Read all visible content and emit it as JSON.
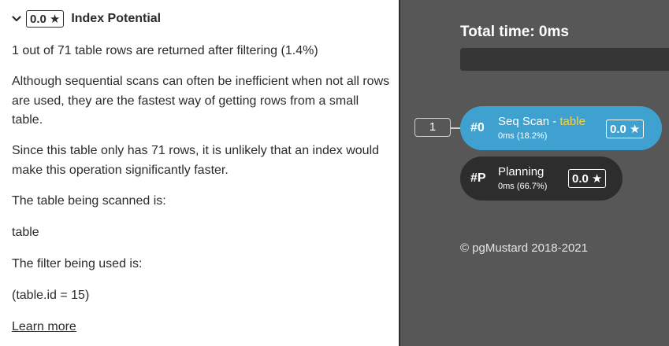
{
  "panel": {
    "score": "0.0",
    "title": "Index Potential",
    "paragraphs": [
      "1 out of 71 table rows are returned after filtering (1.4%)",
      "Although sequential scans can often be inefficient when not all rows are used, they are the fastest way of getting rows from a small table.",
      "Since this table only has 71 rows, it is unlikely that an index would make this operation significantly faster.",
      "The table being scanned is:",
      "table",
      "The filter being used is:",
      "(table.id = 15)"
    ],
    "learn_more": "Learn more"
  },
  "plan": {
    "total_time": "Total time: 0ms",
    "row_count": "1",
    "nodes": [
      {
        "id": "#0",
        "name": "Seq Scan - ",
        "relation": "table",
        "time": "0ms (18.2%)",
        "score": "0.0",
        "color": "#3fa1d0"
      },
      {
        "id": "#P",
        "name": "Planning",
        "relation": "",
        "time": "0ms (66.7%)",
        "score": "0.0",
        "color": "#2d2d2d"
      }
    ],
    "copyright": "© pgMustard 2018-2021"
  },
  "colors": {
    "accent": "#3fa1d0",
    "relation_highlight": "#f3d24a",
    "sidebar_bg": "#575757"
  }
}
